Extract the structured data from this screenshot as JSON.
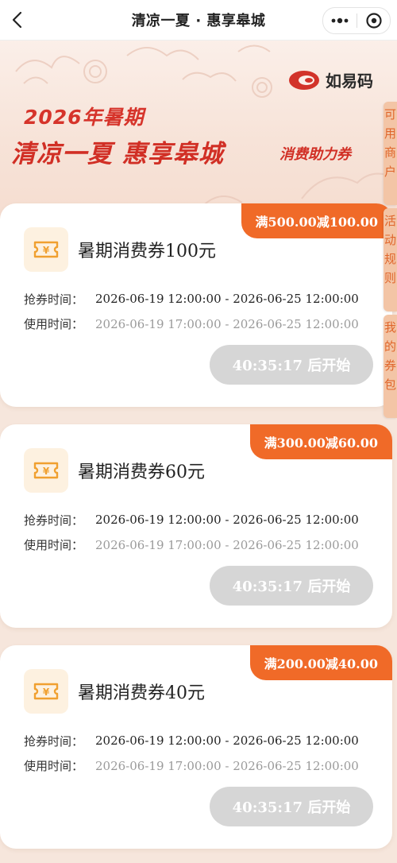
{
  "nav": {
    "title": "清凉一夏 · 惠享皋城"
  },
  "banner": {
    "brand_name": "如易码",
    "year_line": "2026年暑期",
    "headline": "清凉一夏 惠享皋城",
    "headline_sub": "消费助力券"
  },
  "side_tabs": [
    {
      "chars": [
        "可",
        "用",
        "商",
        "户"
      ]
    },
    {
      "chars": [
        "活",
        "动",
        "规",
        "则"
      ]
    },
    {
      "chars": [
        "我",
        "的",
        "券",
        "包"
      ]
    }
  ],
  "labels": {
    "grab_time": "抢券时间：",
    "use_time": "使用时间："
  },
  "coupons": [
    {
      "badge": "满500.00减100.00",
      "title": "暑期消费券100元",
      "grab_time": "2026-06-19 12:00:00 - 2026-06-25 12:00:00",
      "use_time": "2026-06-19 17:00:00 - 2026-06-25 12:00:00",
      "button": "40:35:17 后开始"
    },
    {
      "badge": "满300.00减60.00",
      "title": "暑期消费券60元",
      "grab_time": "2026-06-19 12:00:00 - 2026-06-25 12:00:00",
      "use_time": "2026-06-19 17:00:00 - 2026-06-25 12:00:00",
      "button": "40:35:17 后开始"
    },
    {
      "badge": "满200.00减40.00",
      "title": "暑期消费券40元",
      "grab_time": "2026-06-19 12:00:00 - 2026-06-25 12:00:00",
      "use_time": "2026-06-19 17:00:00 - 2026-06-25 12:00:00",
      "button": "40:35:17 后开始"
    }
  ],
  "colors": {
    "accent": "#f06a28",
    "headline": "#d12f25",
    "disabled_button": "#d6d6d6",
    "side_tab_bg": "#f3c5a6"
  }
}
